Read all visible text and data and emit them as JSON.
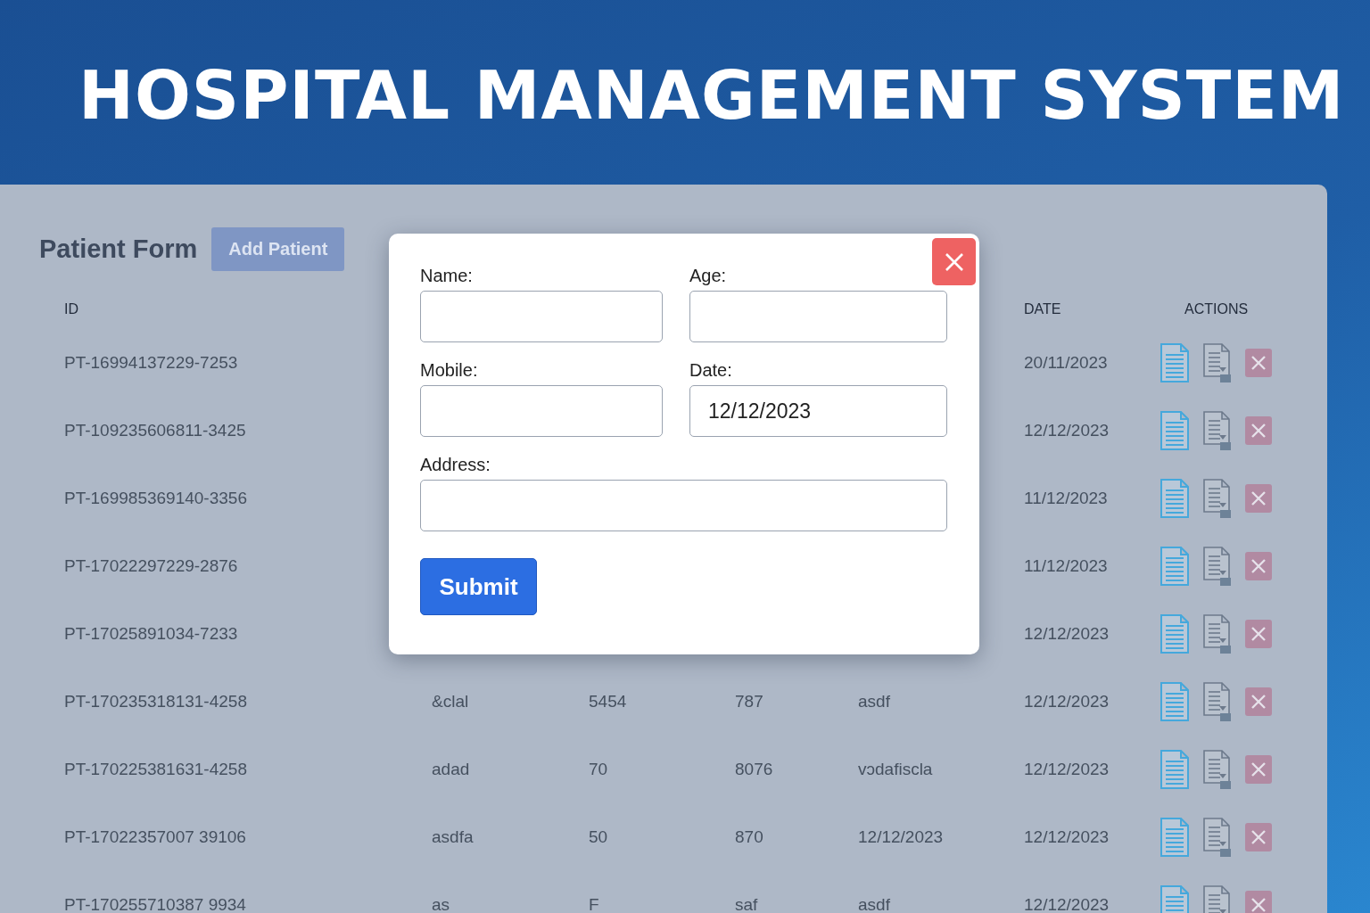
{
  "header": {
    "title": "HOSPITAL MANAGEMENT SYSTEM"
  },
  "panel": {
    "title": "Patient Form",
    "add_button": "Add Patient"
  },
  "table": {
    "headers": [
      "ID",
      "DATE",
      "ACTIONS"
    ],
    "rows": [
      {
        "id": "PT-16994137229-7253",
        "date": "20/11/2023"
      },
      {
        "id": "PT-109235606811-3425",
        "date": "12/12/2023"
      },
      {
        "id": "PT-169985369140-3356",
        "date": "11/12/2023"
      },
      {
        "id": "PT-17022297229-2876",
        "date": "11/12/2023"
      },
      {
        "id": "PT-17025891034-7233",
        "date": "12/12/2023"
      },
      {
        "id": "PT-170235318131-4258",
        "cells": [
          "&clal",
          "5454",
          "787",
          "asdf"
        ],
        "date": "12/12/2023"
      },
      {
        "id": "PT-170225381631-4258",
        "cells": [
          "adad",
          "70",
          "8076",
          "vɔdafiscla"
        ],
        "date": "12/12/2023"
      },
      {
        "id": "PT-17022357007 39106",
        "cells": [
          "asdfa",
          "50",
          "870",
          "12/12/2023"
        ],
        "date": "12/12/2023"
      },
      {
        "id": "PT-170255710387 9934",
        "cells": [
          "as",
          "F",
          "saf",
          "asdf"
        ],
        "date": "12/12/2023"
      }
    ]
  },
  "modal": {
    "fields": [
      {
        "label": "Name:"
      },
      {
        "label": "Age:"
      },
      {
        "label": "Mobile:"
      },
      {
        "label": "Date:",
        "value": "12/12/2023"
      },
      {
        "label": "Address:"
      }
    ],
    "submit": "Submit"
  }
}
